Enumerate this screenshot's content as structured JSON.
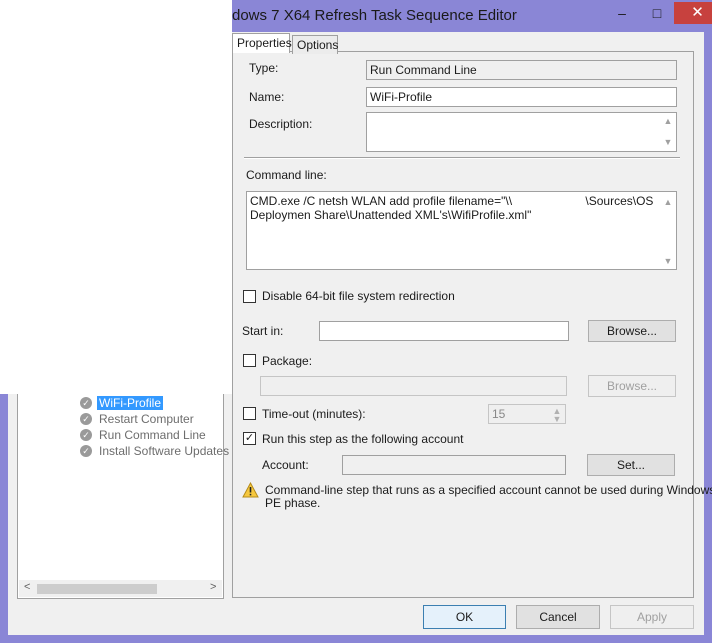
{
  "window": {
    "title": "dows 7 X64 Refresh Task Sequence Editor",
    "minimize": "–",
    "maximize": "□",
    "close": "✕"
  },
  "tree": {
    "items": [
      {
        "label": "WiFi-Profile",
        "selected": true
      },
      {
        "label": "Restart Computer",
        "selected": false
      },
      {
        "label": "Run Command Line",
        "selected": false
      },
      {
        "label": "Install Software Updates",
        "selected": false
      }
    ],
    "scroll_left": "<",
    "scroll_right": ">"
  },
  "tabs": {
    "properties": "Properties",
    "options": "Options"
  },
  "properties": {
    "type_label": "Type:",
    "type_value": "Run Command Line",
    "name_label": "Name:",
    "name_value": "WiFi-Profile",
    "description_label": "Description:",
    "description_value": "",
    "command_line_label": "Command line:",
    "command_line_value_1": "CMD.exe /C netsh WLAN add profile filename=\"\\\\                      \\Sources\\OS",
    "command_line_value_2": "Deploymen Share\\Unattended XML's\\WifiProfile.xml\"",
    "disable_64bit_label": "Disable 64-bit file system redirection",
    "disable_64bit_checked": false,
    "start_in_label": "Start in:",
    "start_in_value": "",
    "browse_label": "Browse...",
    "package_label": "Package:",
    "package_checked": false,
    "package_value": "",
    "package_browse_label": "Browse...",
    "timeout_label": "Time-out (minutes):",
    "timeout_checked": false,
    "timeout_value": "15",
    "run_as_label": "Run this step as the following account",
    "run_as_checked": true,
    "account_label": "Account:",
    "account_value": "",
    "set_label": "Set...",
    "warning_text_1": "Command-line step that runs as a specified account cannot be used during Windows",
    "warning_text_2": "PE phase."
  },
  "footer": {
    "ok": "OK",
    "cancel": "Cancel",
    "apply": "Apply"
  }
}
